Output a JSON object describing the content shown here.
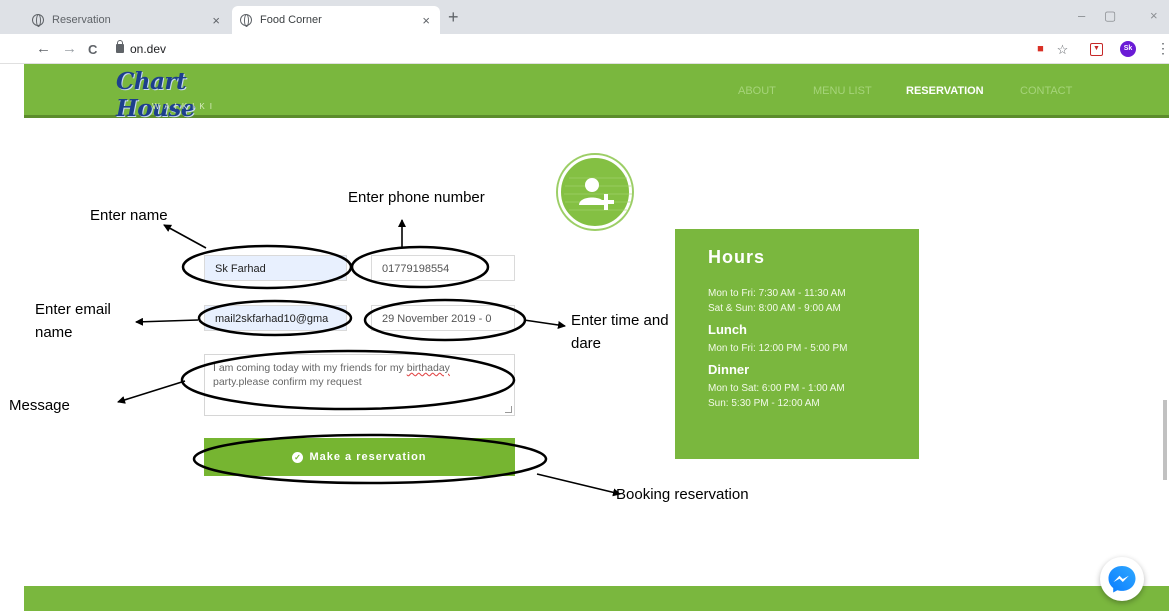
{
  "browser": {
    "tabs": [
      {
        "title": "Reservation"
      },
      {
        "title": "Food Corner"
      }
    ],
    "tab_close": "×",
    "new_tab": "+",
    "window_controls": {
      "minimize": "–",
      "maximize": "▢",
      "close": "×"
    },
    "nav": {
      "back": "←",
      "forward": "→",
      "reload": "C"
    },
    "url": "on.dev",
    "avatar_initials": "Sk"
  },
  "site": {
    "logo_main": "Chart House",
    "logo_sub": "WAIKIKI",
    "nav": [
      {
        "label": "ABOUT"
      },
      {
        "label": "MENU LIST"
      },
      {
        "label": "RESERVATION"
      },
      {
        "label": "CONTACT"
      }
    ],
    "active_nav": "RESERVATION",
    "accent": "#7ab73e"
  },
  "form": {
    "name": "Sk Farhad",
    "phone": "01779198554",
    "email": "mail2skfarhad10@gma",
    "datetime": "29 November 2019 - 0",
    "message_before": "I am coming today with my friends for my ",
    "message_misspelled": "birthaday",
    "message_after": " party.please confirm my request",
    "submit": "Make a reservation"
  },
  "hours": {
    "title": "Hours",
    "lines": [
      "Mon to Fri: 7:30 AM - 11:30 AM",
      "Sat & Sun: 8:00 AM - 9:00 AM"
    ],
    "lunch_title": "Lunch",
    "lunch_lines": [
      "Mon to Fri: 12:00 PM - 5:00 PM"
    ],
    "dinner_title": "Dinner",
    "dinner_lines": [
      "Mon to Sat: 6:00 PM - 1:00 AM",
      "Sun: 5:30 PM - 12:00 AM"
    ]
  },
  "annotations": {
    "name": "Enter name",
    "phone": "Enter phone number",
    "email_line1": "Enter email",
    "email_line2": "name",
    "time_line1": "Enter time and",
    "time_line2": "dare",
    "message": "Message",
    "booking": "Booking reservation"
  }
}
